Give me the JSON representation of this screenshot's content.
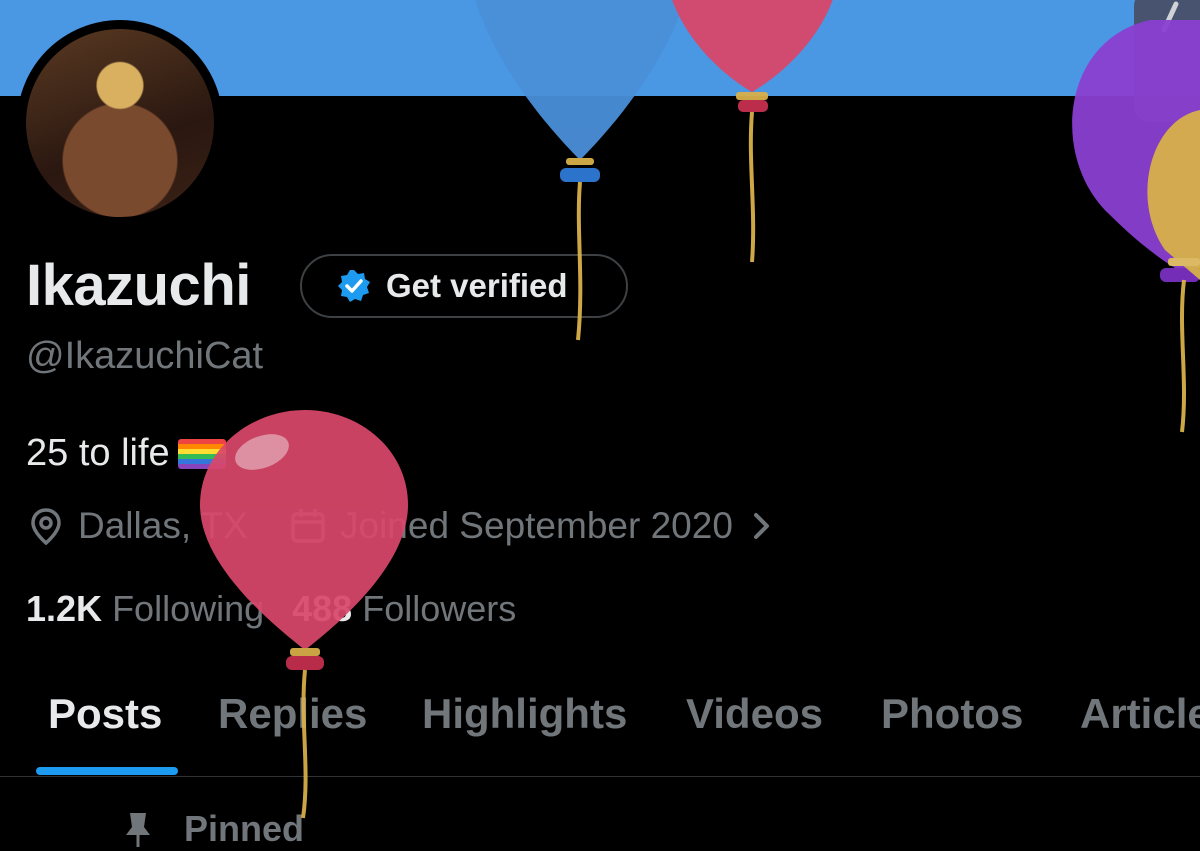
{
  "profile": {
    "display_name": "Ikazuchi",
    "handle": "@IkazuchiCat",
    "verify_button": "Get verified",
    "bio": "25 to life",
    "location": "Dallas, TX",
    "joined": "Joined September 2020",
    "following_count": "1.2K",
    "following_label": "Following",
    "followers_count": "488",
    "followers_label": "Followers"
  },
  "tabs": [
    {
      "label": "Posts",
      "active": true
    },
    {
      "label": "Replies",
      "active": false
    },
    {
      "label": "Highlights",
      "active": false
    },
    {
      "label": "Videos",
      "active": false
    },
    {
      "label": "Photos",
      "active": false
    },
    {
      "label": "Articles",
      "active": false
    }
  ],
  "pinned_label": "Pinned",
  "icons": {
    "verified": "verified-badge-icon",
    "location": "location-pin-icon",
    "calendar": "calendar-icon",
    "chevron": "chevron-right-icon",
    "pin": "pin-icon"
  },
  "colors": {
    "background": "#000000",
    "banner": "#4a97e4",
    "accent": "#1d9bf0",
    "muted_text": "#71767b",
    "primary_text": "#e7e9ea"
  },
  "decorations": {
    "balloon_colors": [
      "#4a8fd8",
      "#d9476a",
      "#8a3fd0",
      "#d7b04a",
      "#d9476a"
    ]
  }
}
